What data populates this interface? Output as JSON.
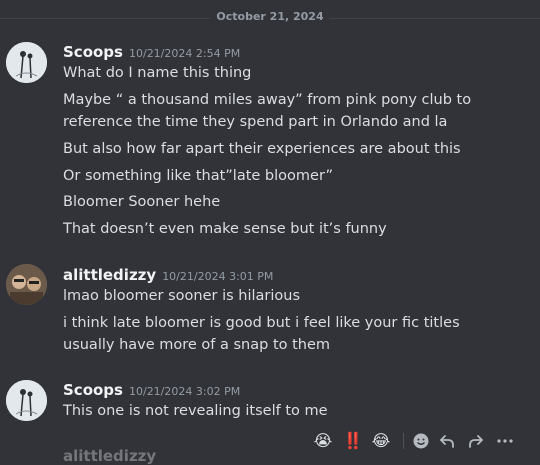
{
  "date_divider": "October 21, 2024",
  "messages": [
    {
      "author": "Scoops",
      "time": "10/21/2024 2:54 PM",
      "lines": [
        "What do I name this thing",
        "Maybe “ a thousand miles away” from pink pony club to",
        "reference the time they spend part in Orlando and la",
        "But also how far apart their experiences are about this",
        "Or something like that”late bloomer”",
        "Bloomer Sooner hehe",
        "That doesn’t even make sense but it’s funny"
      ]
    },
    {
      "author": "alittledizzy",
      "time": "10/21/2024 3:01 PM",
      "lines": [
        "lmao bloomer sooner is hilarious",
        "i think late bloomer is good but i feel like your fic titles",
        "usually have more of a snap to them"
      ]
    },
    {
      "author": "Scoops",
      "time": "10/21/2024 3:02 PM",
      "lines": [
        "This one is not revealing itself to me"
      ]
    }
  ],
  "next_author_partial": "alittledizzy",
  "toolbar": {
    "reactions": [
      "😭",
      "‼️",
      "😂"
    ],
    "add_reaction_icon": "smile-plus-icon",
    "reply_icon": "reply-arrow-icon",
    "forward_icon": "forward-arrow-icon",
    "more_icon": "more-dots-icon"
  }
}
